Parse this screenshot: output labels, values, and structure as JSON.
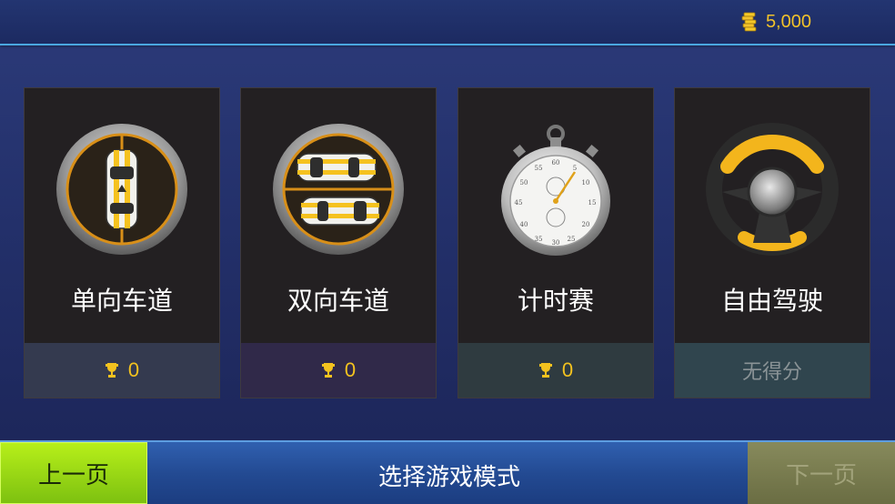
{
  "header": {
    "coin_amount": "5,000",
    "coin_icon": "coin-stack-icon"
  },
  "modes": [
    {
      "title": "单向车道",
      "score": "0",
      "score_bg": "#343a4f",
      "icon": "one-way-lane-icon"
    },
    {
      "title": "双向车道",
      "score": "0",
      "score_bg": "#302949",
      "icon": "two-way-lane-icon"
    },
    {
      "title": "计时赛",
      "score": "0",
      "score_bg": "#2f3b40",
      "icon": "stopwatch-icon"
    },
    {
      "title": "自由驾驶",
      "score": "无得分",
      "score_bg": "#30454e",
      "icon": "steering-wheel-icon"
    }
  ],
  "footer": {
    "title": "选择游戏模式",
    "prev_label": "上一页",
    "next_label": "下一页"
  },
  "colors": {
    "accent": "#f3c21f",
    "prev_button": "#a6e414",
    "next_button": "#7f8049"
  }
}
